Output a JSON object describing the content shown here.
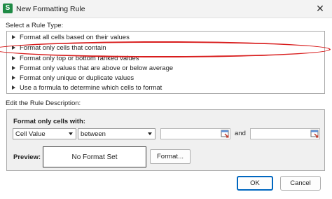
{
  "window": {
    "title": "New Formatting Rule",
    "close_glyph": "✕",
    "app_icon_letter": "S",
    "app_icon_color": "#1f8a45"
  },
  "rule_type": {
    "label": "Select a Rule Type:",
    "items": [
      {
        "label": "Format all cells based on their values"
      },
      {
        "label": "Format only cells that contain"
      },
      {
        "label": "Format only top or bottom ranked values"
      },
      {
        "label": "Format only values that are above or below average"
      },
      {
        "label": "Format only unique or duplicate values"
      },
      {
        "label": "Use a formula to determine which cells to format"
      }
    ],
    "selected_index": 1,
    "highlight_color": "#d81c1c"
  },
  "description": {
    "label": "Edit the Rule Description:",
    "format_only_label": "Format only cells with:",
    "condition_field": "Cell Value",
    "operator": "between",
    "value1": "",
    "value2": "",
    "and_label": "and"
  },
  "preview": {
    "label": "Preview:",
    "text": "No Format Set",
    "format_button": "Format..."
  },
  "buttons": {
    "ok": "OK",
    "cancel": "Cancel"
  },
  "icons": {
    "range_selector": "range-select-icon",
    "expand_arrow": "triangle-right-icon",
    "dropdown": "chevron-down-icon"
  }
}
